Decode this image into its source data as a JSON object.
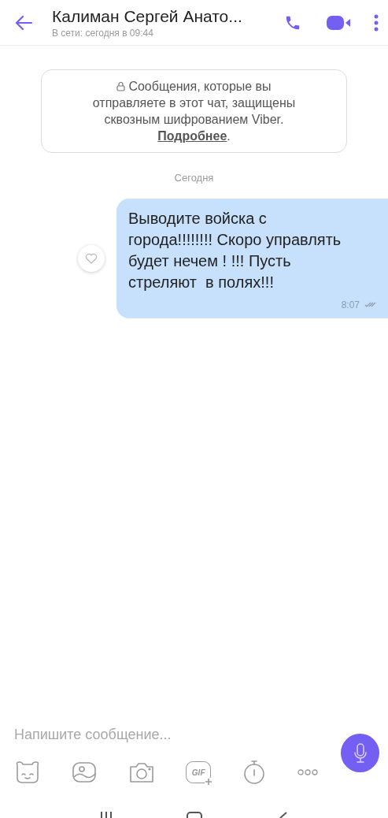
{
  "header": {
    "title": "Калиман Сергей Анато...",
    "status": "В сети: сегодня в 09:44"
  },
  "notice": {
    "lines": [
      "Сообщения, которые вы",
      "отправляете в этот чат, защищены",
      "сквозным шифрованием Viber."
    ],
    "link": "Подробнее",
    "after": "."
  },
  "date_divider": "Сегодня",
  "messages": [
    {
      "text": "Выводите войска с города!!!!!!!! Скоро управлять будет нечем ! !!! Пусть стреляют  в полях!!!",
      "time": "8:07",
      "read": true,
      "liked": false
    }
  ],
  "composer": {
    "placeholder": "Напишите сообщение..."
  },
  "toolbar": [
    {
      "kind": "sticker"
    },
    {
      "kind": "gallery"
    },
    {
      "kind": "camera"
    },
    {
      "kind": "gif",
      "label": "GIF"
    },
    {
      "kind": "timer"
    },
    {
      "kind": "more"
    }
  ]
}
